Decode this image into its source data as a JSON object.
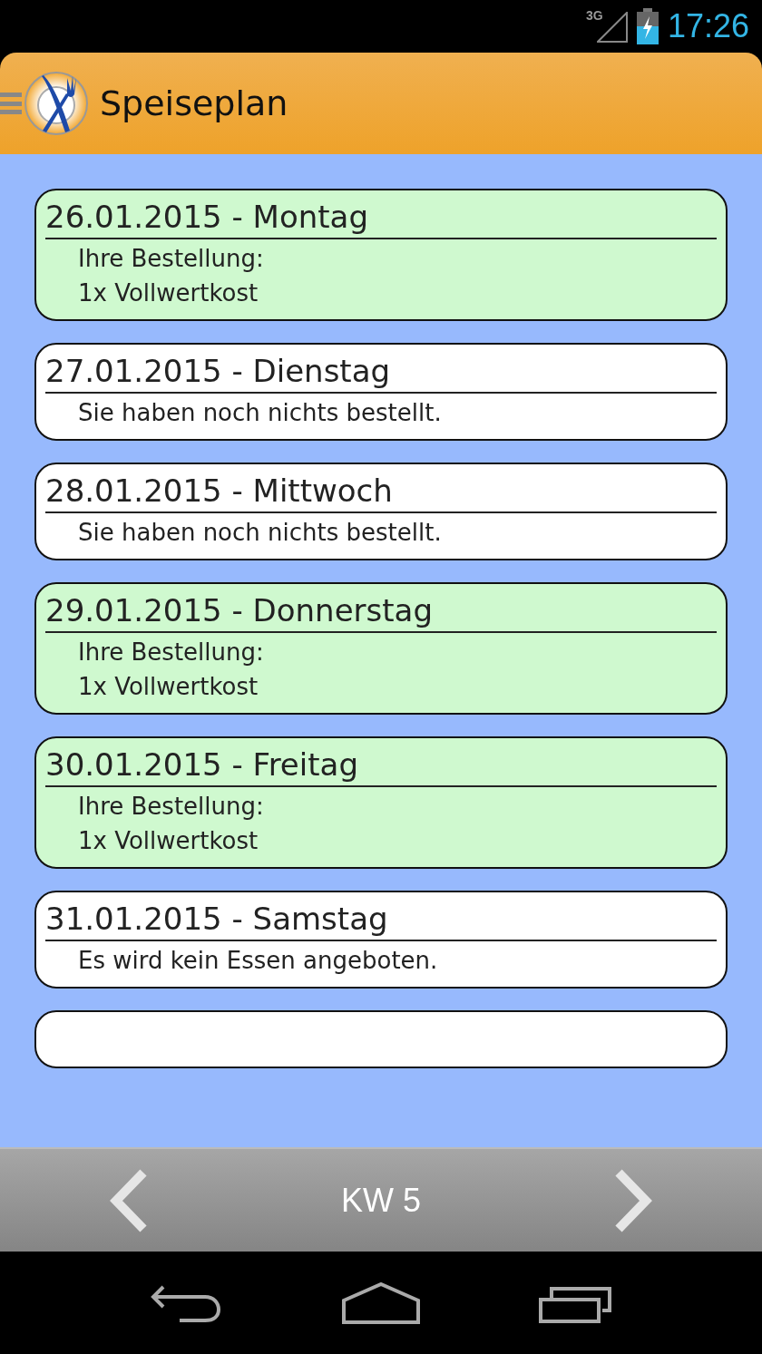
{
  "status_bar": {
    "network": "3G",
    "time": "17:26"
  },
  "app_bar": {
    "title": "Speiseplan"
  },
  "days": [
    {
      "date": "26.01.2015 - Montag",
      "ordered": true,
      "lines": [
        "Ihre Bestellung:",
        "1x Vollwertkost"
      ]
    },
    {
      "date": "27.01.2015 - Dienstag",
      "ordered": false,
      "lines": [
        "Sie haben noch nichts bestellt."
      ]
    },
    {
      "date": "28.01.2015 - Mittwoch",
      "ordered": false,
      "lines": [
        "Sie haben noch nichts bestellt."
      ]
    },
    {
      "date": "29.01.2015 - Donnerstag",
      "ordered": true,
      "lines": [
        "Ihre Bestellung:",
        "1x Vollwertkost"
      ]
    },
    {
      "date": "30.01.2015 - Freitag",
      "ordered": true,
      "lines": [
        "Ihre Bestellung:",
        "1x Vollwertkost"
      ]
    },
    {
      "date": "31.01.2015 - Samstag",
      "ordered": false,
      "lines": [
        "Es wird kein Essen angeboten."
      ]
    }
  ],
  "week_bar": {
    "label": "KW 5"
  }
}
